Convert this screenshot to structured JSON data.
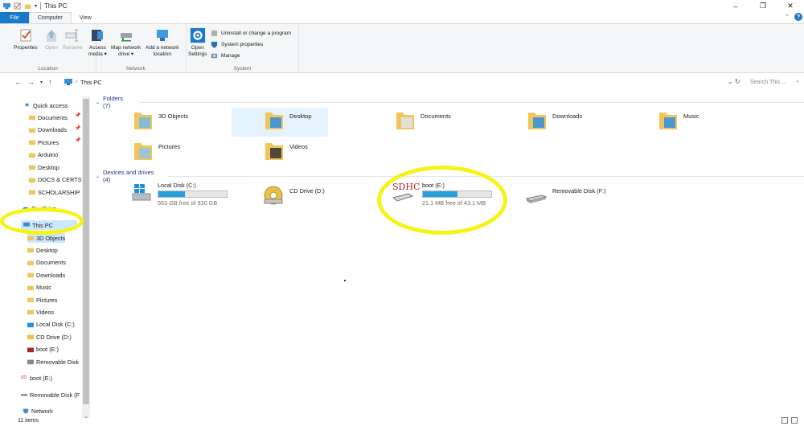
{
  "window": {
    "title": "This PC",
    "controls": {
      "minimize": "–",
      "maximize": "❐",
      "close": "✕"
    }
  },
  "ribbon_tabs": [
    "File",
    "Computer",
    "View"
  ],
  "ribbon": {
    "location": {
      "label": "Location",
      "properties": "Properties",
      "open": "Open",
      "rename": "Rename"
    },
    "network": {
      "label": "Network",
      "access_media": [
        "Access",
        "media ▾"
      ],
      "map_network_drive": [
        "Map network",
        "drive ▾"
      ],
      "add_network_location": [
        "Add a network",
        "location"
      ]
    },
    "system": {
      "label": "System",
      "open_settings": [
        "Open",
        "Settings"
      ],
      "uninstall": "Uninstall or change a program",
      "system_properties": "System properties",
      "manage": "Manage"
    }
  },
  "address": {
    "path": "This PC",
    "search_placeholder": "Search This ..."
  },
  "nav": {
    "quick_access": "Quick access",
    "quick_items": [
      "Documents",
      "Downloads",
      "Pictures",
      "Arduino",
      "Desktop",
      "DOCS & CERTS",
      "SCHOLARSHIP"
    ],
    "onedrive": "OneDrive",
    "this_pc": "This PC",
    "pc_items": [
      "3D Objects",
      "Desktop",
      "Documents",
      "Downloads",
      "Music",
      "Pictures",
      "Videos",
      "Local Disk (C:)",
      "CD Drive (D:)",
      "boot (E:)",
      "Removable Disk"
    ],
    "boot": "boot (E:)",
    "removable": "Removable Disk (F",
    "network": "Network"
  },
  "folders_section": "Folders (7)",
  "folders": [
    "3D Objects",
    "Desktop",
    "Documents",
    "Downloads",
    "Music",
    "Pictures",
    "Videos"
  ],
  "drives_section": "Devices and drives (4)",
  "drives": [
    {
      "name": "Local Disk (C:)",
      "free": "563 GB free of 930 GB",
      "used_fraction": 0.39
    },
    {
      "name": "CD Drive (D:)"
    },
    {
      "name": "boot (E:)",
      "free": "21.1 MB free of 43.1 MB",
      "used_fraction": 0.51,
      "badge": "SDHC"
    },
    {
      "name": "Removable Disk (F:)"
    }
  ],
  "status": {
    "items": "11 items"
  },
  "colors": {
    "accent": "#1979ca",
    "highlight": "#f6f316",
    "bar_fill": "#26a0da",
    "selection": "#cce8ff"
  }
}
